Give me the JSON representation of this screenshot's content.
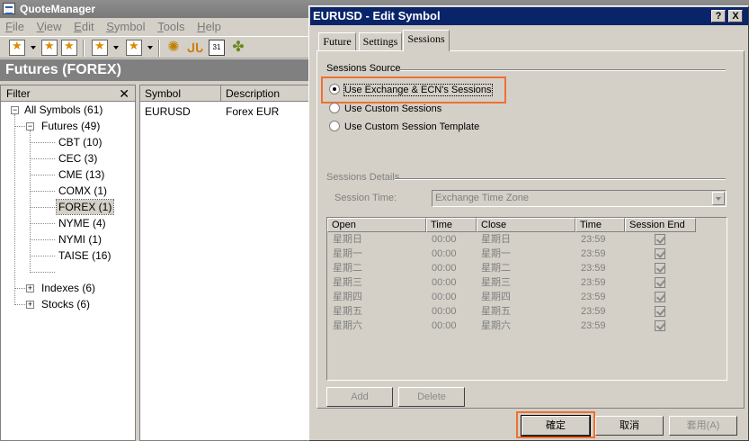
{
  "main_window": {
    "title": "QuoteManager",
    "menu": [
      "File",
      "View",
      "Edit",
      "Symbol",
      "Tools",
      "Help"
    ],
    "toolbar_icons": [
      "new-symbol-icon",
      "edit-symbol-icon",
      "import-icon",
      "export-icon",
      "gear-icon",
      "flame-icon",
      "calendar-icon",
      "puzzle-icon"
    ],
    "page_header": "Futures (FOREX)"
  },
  "filter": {
    "title": "Filter",
    "close": "✕",
    "tree": {
      "root": "All Symbols  (61)",
      "futures": "Futures  (49)",
      "futures_children": [
        "CBT  (10)",
        "CEC  (3)",
        "CME  (13)",
        "COMX  (1)",
        "FOREX  (1)",
        "NYME  (4)",
        "NYMI  (1)",
        "TAISE  (16)"
      ],
      "indexes": "Indexes  (6)",
      "stocks": "Stocks  (6)",
      "selected": "FOREX  (1)"
    }
  },
  "symbol_list": {
    "columns": [
      "Symbol",
      "Description"
    ],
    "rows": [
      {
        "symbol": "EURUSD",
        "description": "Forex EUR"
      }
    ]
  },
  "dialog": {
    "title": "EURUSD - Edit Symbol",
    "help_btn": "?",
    "close_btn": "X",
    "tabs": [
      "Future",
      "Settings",
      "Sessions"
    ],
    "active_tab": "Sessions",
    "sessions_source": {
      "label": "Sessions Source",
      "options": [
        "Use Exchange & ECN's Sessions",
        "Use Custom Sessions",
        "Use Custom Session Template"
      ],
      "selected": "Use Exchange & ECN's Sessions"
    },
    "sessions_details": {
      "label": "Sessions Details",
      "session_time_label": "Session Time:",
      "session_time_value": "Exchange Time Zone",
      "columns": [
        "Open",
        "Time",
        "Close",
        "Time",
        "Session End"
      ],
      "rows": [
        {
          "open": "星期日",
          "open_time": "00:00",
          "close": "星期日",
          "close_time": "23:59",
          "session_end": true
        },
        {
          "open": "星期一",
          "open_time": "00:00",
          "close": "星期一",
          "close_time": "23:59",
          "session_end": true
        },
        {
          "open": "星期二",
          "open_time": "00:00",
          "close": "星期二",
          "close_time": "23:59",
          "session_end": true
        },
        {
          "open": "星期三",
          "open_time": "00:00",
          "close": "星期三",
          "close_time": "23:59",
          "session_end": true
        },
        {
          "open": "星期四",
          "open_time": "00:00",
          "close": "星期四",
          "close_time": "23:59",
          "session_end": true
        },
        {
          "open": "星期五",
          "open_time": "00:00",
          "close": "星期五",
          "close_time": "23:59",
          "session_end": true
        },
        {
          "open": "星期六",
          "open_time": "00:00",
          "close": "星期六",
          "close_time": "23:59",
          "session_end": true
        }
      ],
      "add_label": "Add",
      "delete_label": "Delete"
    },
    "buttons": {
      "ok": "確定",
      "cancel": "取消",
      "apply": "套用(A)"
    }
  },
  "colors": {
    "highlight": "#f07030",
    "title_active": "#0a246a",
    "title_inactive": "#808080"
  }
}
